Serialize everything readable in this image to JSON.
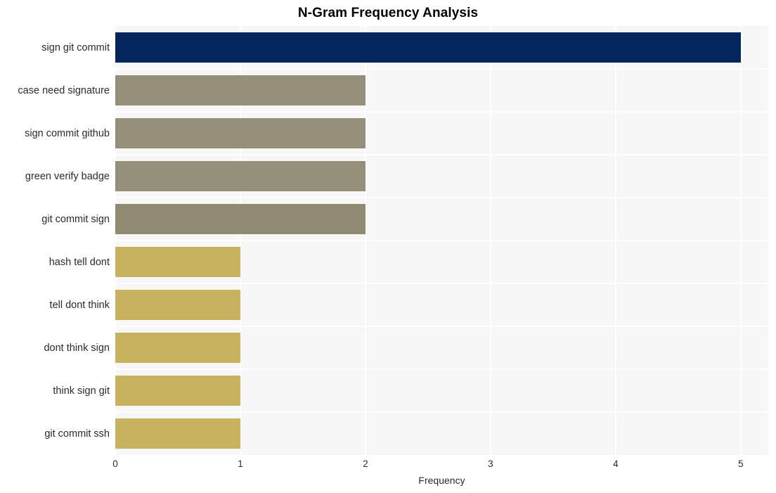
{
  "chart_data": {
    "type": "bar",
    "orientation": "horizontal",
    "title": "N-Gram Frequency Analysis",
    "xlabel": "Frequency",
    "ylabel": "",
    "xlim": [
      0,
      5.22
    ],
    "xticks": [
      0,
      1,
      2,
      3,
      4,
      5
    ],
    "xtick_labels": [
      "0",
      "1",
      "2",
      "3",
      "4",
      "5"
    ],
    "grid": true,
    "legend": false,
    "categories": [
      "sign git commit",
      "case need signature",
      "sign commit github",
      "green verify badge",
      "git commit sign",
      "hash tell dont",
      "tell dont think",
      "dont think sign",
      "think sign git",
      "git commit ssh"
    ],
    "values": [
      5,
      2,
      2,
      2,
      2,
      1,
      1,
      1,
      1,
      1
    ],
    "bar_colors": [
      "#04245c",
      "#958e78",
      "#958e78",
      "#958e78",
      "#908a73",
      "#c7b35f",
      "#c7b35f",
      "#c7b35f",
      "#c7b35f",
      "#c7b35f"
    ],
    "plot_background": "#f7f7f7",
    "page_background": "#ffffff",
    "gridline_color": "#ffffff",
    "text_color": "#2b2b2b",
    "title_color": "#000000"
  }
}
